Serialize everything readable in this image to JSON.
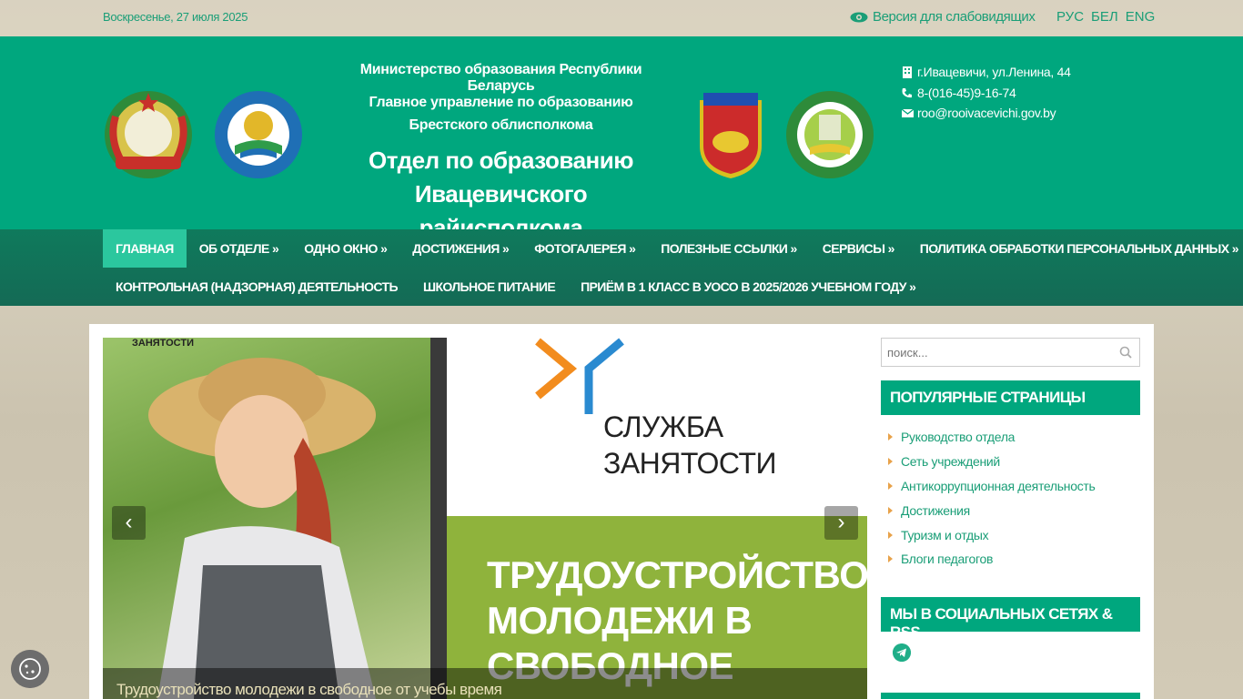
{
  "topbar": {
    "date": "Воскресенье, 27 июля 2025",
    "vision_label": "Версия для слабовидящих",
    "langs": [
      "РУС",
      "БЕЛ",
      "ENG"
    ]
  },
  "header": {
    "line1": "Министерство образования Республики Беларусь",
    "line2": "Главное управление по образованию Брестского облисполкома",
    "title": "Отдел по образованию Ивацевичского райисполкома",
    "address": "г.Ивацевичи, ул.Ленина, 44",
    "phone": "8-(016-45)9-16-74",
    "email": "roo@rooivacevichi.gov.by"
  },
  "nav": {
    "row1": [
      "ГЛАВНАЯ",
      "ОБ ОТДЕЛЕ »",
      "ОДНО ОКНО »",
      "ДОСТИЖЕНИЯ »",
      "ФОТОГАЛЕРЕЯ »",
      "ПОЛЕЗНЫЕ ССЫЛКИ »",
      "СЕРВИСЫ »",
      "ПОЛИТИКА ОБРАБОТКИ ПЕРСОНАЛЬНЫХ ДАННЫХ »"
    ],
    "row2": [
      "КОНТРОЛЬНАЯ (НАДЗОРНАЯ) ДЕЯТЕЛЬНОСТЬ",
      "ШКОЛЬНОЕ ПИТАНИЕ",
      "ПРИЁМ В 1 КЛАСС В УОСО В 2025/2026 УЧЕБНОМ ГОДУ »"
    ]
  },
  "slider": {
    "zan_label": "ЗАНЯТОСТИ",
    "logo_text": "СЛУЖБА ЗАНЯТОСТИ",
    "big_text": "ТРУДОУСТРОЙСТВО МОЛОДЕЖИ В СВОБОДНОЕ",
    "caption": "Трудоустройство молодежи в свободное от учебы время",
    "prev": "‹",
    "next": "›"
  },
  "sidebar": {
    "search_placeholder": "поиск...",
    "popular_title": "ПОПУЛЯРНЫЕ СТРАНИЦЫ",
    "popular_items": [
      "Руководство отдела",
      "Сеть учреждений",
      "Антикоррупционная деятельность",
      "Достижения",
      "Туризм и отдых",
      "Блоги педагогов"
    ],
    "social_title": "МЫ В СОЦИАЛЬНЫХ СЕТЯХ & RSS"
  },
  "colors": {
    "brand": "#00a77e",
    "nav": "#146a55",
    "active": "#2bc79e",
    "link": "#1a9e77"
  }
}
